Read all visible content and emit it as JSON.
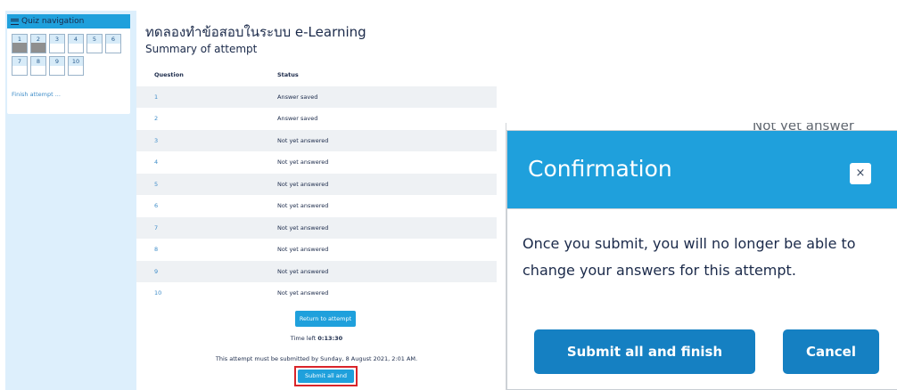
{
  "quiz_nav": {
    "title": "Quiz navigation",
    "questions": [
      {
        "num": "1",
        "answered": true
      },
      {
        "num": "2",
        "answered": true
      },
      {
        "num": "3",
        "answered": false
      },
      {
        "num": "4",
        "answered": false
      },
      {
        "num": "5",
        "answered": false
      },
      {
        "num": "6",
        "answered": false
      },
      {
        "num": "7",
        "answered": false
      },
      {
        "num": "8",
        "answered": false
      },
      {
        "num": "9",
        "answered": false
      },
      {
        "num": "10",
        "answered": false
      }
    ],
    "finish_label": "Finish attempt ..."
  },
  "summary": {
    "heading": "ทดลองทำข้อสอบในระบบ e-Learning",
    "subheading": "Summary of attempt",
    "col_question": "Question",
    "col_status": "Status",
    "rows": [
      {
        "q": "1",
        "status": "Answer saved"
      },
      {
        "q": "2",
        "status": "Answer saved"
      },
      {
        "q": "3",
        "status": "Not yet answered"
      },
      {
        "q": "4",
        "status": "Not yet answered"
      },
      {
        "q": "5",
        "status": "Not yet answered"
      },
      {
        "q": "6",
        "status": "Not yet answered"
      },
      {
        "q": "7",
        "status": "Not yet answered"
      },
      {
        "q": "8",
        "status": "Not yet answered"
      },
      {
        "q": "9",
        "status": "Not yet answered"
      },
      {
        "q": "10",
        "status": "Not yet answered"
      }
    ],
    "return_label": "Return to attempt",
    "time_left_prefix": "Time left ",
    "time_left_value": "0:13:30",
    "deadline_text": "This attempt must be submitted by Sunday, 8 August 2021, 2:01 AM.",
    "submit_label": "Submit all and finish"
  },
  "dialog": {
    "behind_text": "Not yet answer",
    "title": "Confirmation",
    "close_glyph": "×",
    "message": "Once you submit, you will no longer be able to change your answers for this attempt.",
    "submit_label": "Submit all and finish",
    "cancel_label": "Cancel"
  },
  "colors": {
    "accent": "#1fa0dc",
    "button_dark": "#1580c2",
    "highlight_border": "#d9252a",
    "panel_bg": "#ddeffc"
  }
}
